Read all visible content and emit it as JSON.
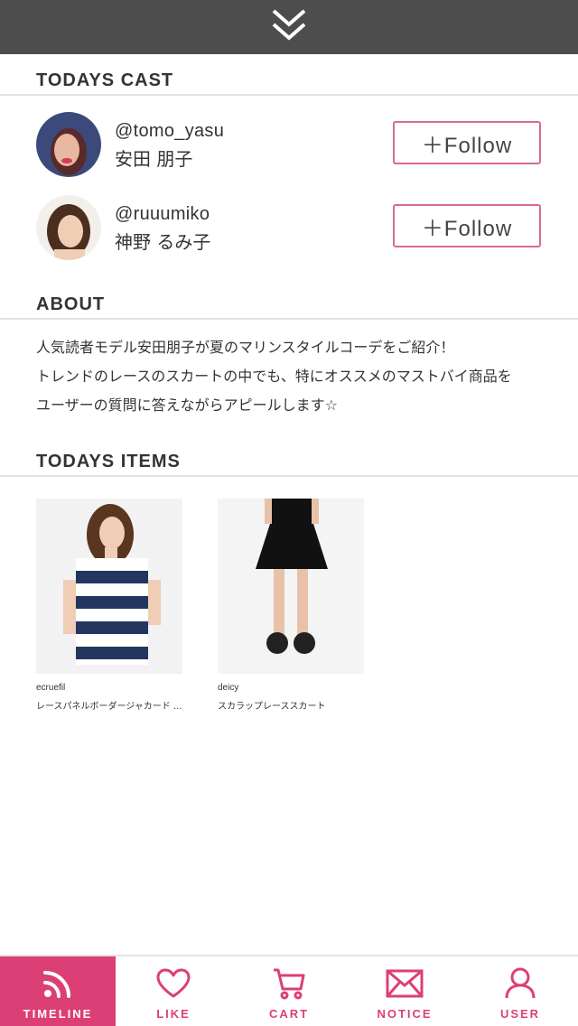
{
  "header": {
    "icon": "double-chevron-down-icon"
  },
  "todays_cast": {
    "title": "TODAYS CAST",
    "members": [
      {
        "handle": "@tomo_yasu",
        "name": "安田 朋子",
        "follow_label": "＋Follow"
      },
      {
        "handle": "@ruuumiko",
        "name": "神野 るみ子",
        "follow_label": "＋Follow"
      }
    ]
  },
  "about": {
    "title": "ABOUT",
    "lines": [
      "人気読者モデル安田朋子が夏のマリンスタイルコーデをご紹介！",
      "トレンドのレースのスカートの中でも、特にオススメのマストバイ商品を",
      "ユーザーの質問に答えながらアピールします☆"
    ]
  },
  "todays_items": {
    "title": "TODAYS ITEMS",
    "items": [
      {
        "brand": "ecruefil",
        "name": "レースパネルボーダージャカード ..."
      },
      {
        "brand": "deicy",
        "name": "スカラップレーススカート"
      }
    ]
  },
  "nav": {
    "items": [
      {
        "label": "TIMELINE",
        "icon": "rss-icon",
        "active": true
      },
      {
        "label": "LIKE",
        "icon": "heart-icon",
        "active": false
      },
      {
        "label": "CART",
        "icon": "cart-icon",
        "active": false
      },
      {
        "label": "NOTICE",
        "icon": "mail-icon",
        "active": false
      },
      {
        "label": "USER",
        "icon": "user-icon",
        "active": false
      }
    ]
  },
  "colors": {
    "accent": "#dc3f75",
    "follow_border": "#d86a96",
    "topbar": "#4d4d4d"
  }
}
